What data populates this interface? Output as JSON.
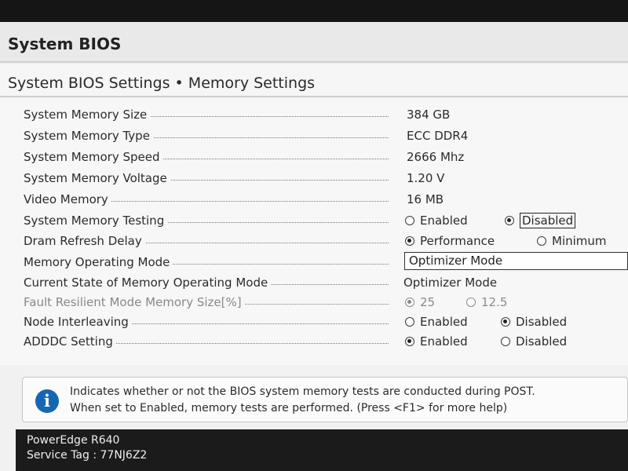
{
  "app_title": "System BIOS",
  "page_title": "System BIOS Settings • Memory Settings",
  "rows": [
    {
      "label": "System Memory Size",
      "value": "384 GB"
    },
    {
      "label": "System Memory Type",
      "value": "ECC DDR4"
    },
    {
      "label": "System Memory Speed",
      "value": "2666 Mhz"
    },
    {
      "label": "System Memory Voltage",
      "value": "1.20 V"
    },
    {
      "label": "Video Memory",
      "value": "16 MB"
    },
    {
      "label": "System Memory Testing",
      "options": [
        "Enabled",
        "Disabled"
      ],
      "selected": "Disabled"
    },
    {
      "label": "Dram Refresh Delay",
      "options": [
        "Performance",
        "Minimum"
      ],
      "selected": "Performance"
    },
    {
      "label": "Memory Operating Mode",
      "select_value": "Optimizer Mode"
    },
    {
      "label": "Current State of Memory Operating Mode",
      "value": "Optimizer Mode"
    },
    {
      "label": "Fault Resilient Mode Memory Size[%]",
      "options": [
        "25",
        "12.5"
      ],
      "selected": "25"
    },
    {
      "label": "Node Interleaving",
      "options": [
        "Enabled",
        "Disabled"
      ],
      "selected": "Disabled"
    },
    {
      "label": "ADDDC Setting",
      "options": [
        "Enabled",
        "Disabled"
      ],
      "selected": "Enabled"
    }
  ],
  "help": {
    "line1": "Indicates whether or not the BIOS system memory tests are conducted during POST.",
    "line2": "When set to Enabled, memory tests are performed. (Press <F1> for more help)"
  },
  "footer": {
    "model": "PowerEdge R640",
    "service_tag": "Service Tag : 77NJ6Z2"
  },
  "icons": {
    "help_icon": "info-icon"
  },
  "colors": {
    "info_blue": "#1567b3",
    "footer_bg": "#1b1b1b"
  }
}
